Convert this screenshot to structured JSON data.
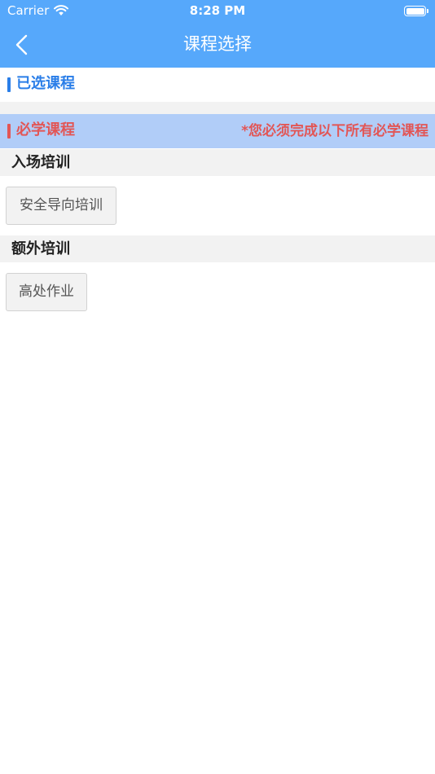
{
  "status_bar": {
    "carrier": "Carrier",
    "time": "8:28 PM"
  },
  "nav": {
    "title": "课程选择",
    "back_icon": "chevron-left-icon"
  },
  "selected_section": {
    "label": "已选课程"
  },
  "required_section": {
    "label": "必学课程",
    "notice": "*您必须完成以下所有必学课程"
  },
  "categories": [
    {
      "label": "入场培训",
      "courses": [
        "安全导向培训"
      ]
    },
    {
      "label": "额外培训",
      "courses": [
        "高处作业"
      ]
    }
  ],
  "colors": {
    "header_bg": "#56a8fb",
    "accent_blue": "#2a7ee8",
    "required_bg": "#b1cdf8",
    "required_red": "#e25656"
  }
}
